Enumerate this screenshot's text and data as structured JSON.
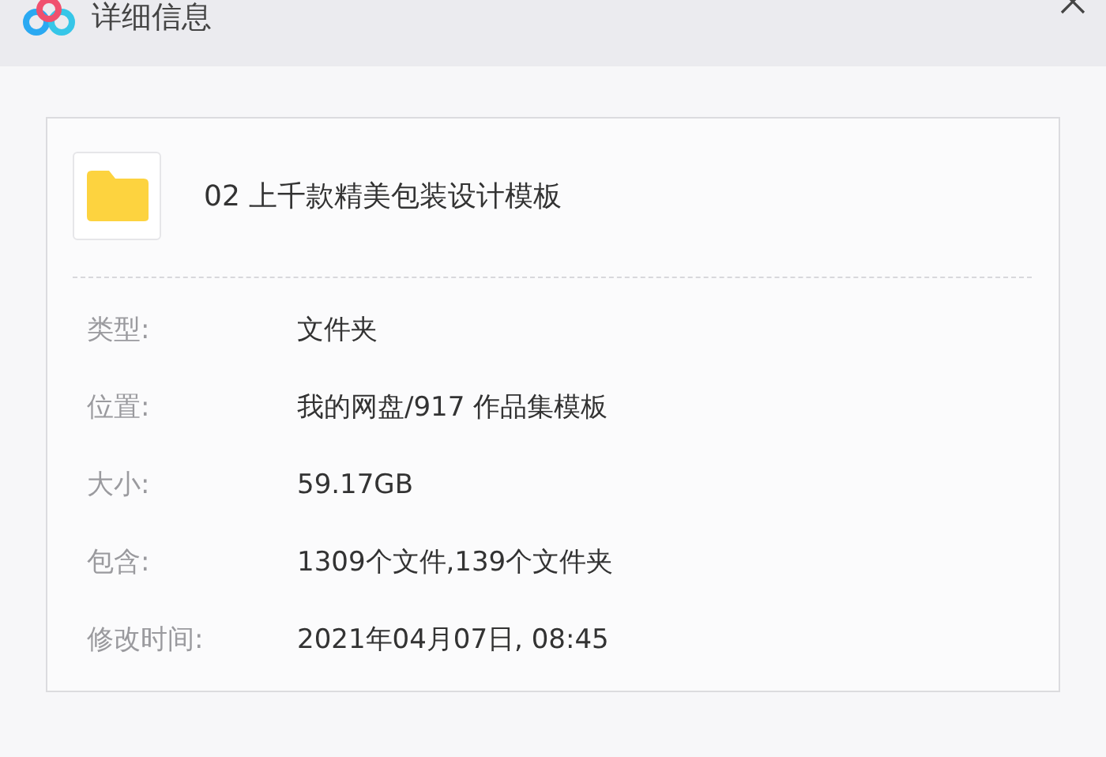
{
  "window": {
    "title": "详细信息"
  },
  "file": {
    "kind": "folder",
    "name": "02 上千款精美包装设计模板"
  },
  "properties": [
    {
      "label": "类型:",
      "value": "文件夹"
    },
    {
      "label": "位置:",
      "value": "我的网盘/917 作品集模板"
    },
    {
      "label": "大小:",
      "value": "59.17GB"
    },
    {
      "label": "包含:",
      "value": "1309个文件,139个文件夹"
    },
    {
      "label": "修改时间:",
      "value": "2021年04月07日, 08:45"
    }
  ]
}
